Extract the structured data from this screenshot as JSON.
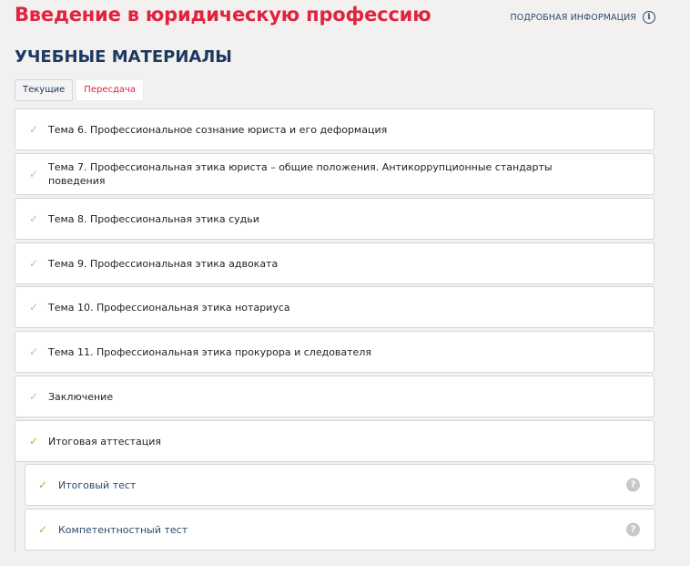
{
  "header": {
    "course_title": "Введение в юридическую профессию",
    "more_info_label": "ПОДРОБНАЯ ИНФОРМАЦИЯ",
    "info_icon": "info-circle-icon"
  },
  "materials": {
    "section_title": "УЧЕБНЫЕ МАТЕРИАЛЫ",
    "tabs": [
      {
        "label": "Текущие",
        "active": true
      },
      {
        "label": "Пересдача",
        "active": false
      }
    ],
    "topics": [
      {
        "label": "Тема 6. Профессиональное сознание юриста и его деформация",
        "completed": false
      },
      {
        "label": "Тема 7. Профессиональная этика юриста – общие положения. Антикоррупционные стандарты поведения",
        "completed": false
      },
      {
        "label": "Тема 8. Профессиональная этика судьи",
        "completed": false
      },
      {
        "label": "Тема 9. Профессиональная этика адвоката",
        "completed": false
      },
      {
        "label": "Тема 10. Профессиональная этика нотариуса",
        "completed": false
      },
      {
        "label": "Тема 11. Профессиональная этика прокурора и следователя",
        "completed": false
      },
      {
        "label": "Заключение",
        "completed": false
      },
      {
        "label": "Итоговая аттестация",
        "completed": true
      }
    ],
    "final_items": [
      {
        "label": "Итоговый тест",
        "completed": true,
        "help_icon": "question-circle-icon"
      },
      {
        "label": "Компетентностный тест",
        "completed": true,
        "help_icon": "question-circle-icon"
      }
    ]
  },
  "colors": {
    "accent_red": "#e02440",
    "navy": "#1c3a61",
    "check_green": "#8ac43f",
    "check_grey": "#bcbcbc"
  }
}
